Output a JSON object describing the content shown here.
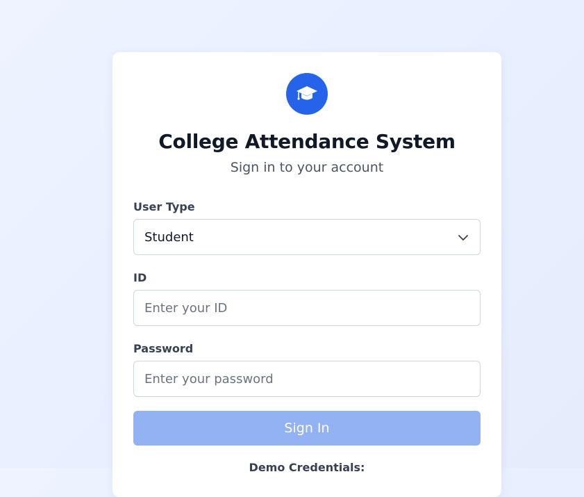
{
  "app": {
    "title": "College Attendance System",
    "subtitle": "Sign in to your account",
    "logo_icon": "graduation-cap-icon",
    "accent_color": "#2563eb"
  },
  "form": {
    "user_type": {
      "label": "User Type",
      "selected": "Student"
    },
    "id": {
      "label": "ID",
      "value": "",
      "placeholder": "Enter your ID"
    },
    "password": {
      "label": "Password",
      "value": "",
      "placeholder": "Enter your password"
    },
    "submit_label": "Sign In",
    "submit_color": "#93b2f3"
  },
  "demo": {
    "heading": "Demo Credentials:"
  }
}
